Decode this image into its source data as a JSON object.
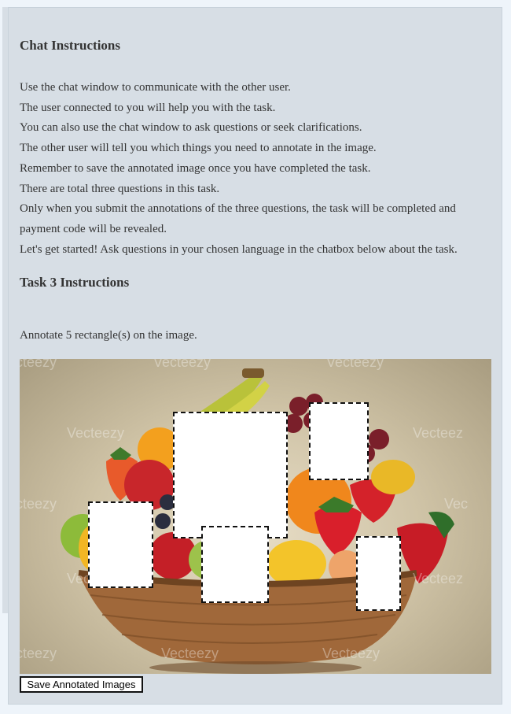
{
  "chat": {
    "title": "Chat Instructions",
    "lines": [
      "Use the chat window to communicate with the other user.",
      "The user connected to you will help you with the task.",
      "You can also use the chat window to ask questions or seek clarifications.",
      "The other user will tell you which things you need to annotate in the image.",
      "Remember to save the annotated image once you have completed the task.",
      "There are total three questions in this task.",
      "Only when you submit the annotations of the three questions, the task will be completed and payment code will be revealed.",
      "Let's get started! Ask questions in your chosen language in the chatbox below about the task."
    ]
  },
  "task": {
    "title": "Task 3 Instructions",
    "instruction": "Annotate 5 rectangle(s) on the image."
  },
  "image": {
    "watermark": "Vecteezy",
    "rectangle_count": 5
  },
  "save_button_label": "Save Annotated Images",
  "colors": {
    "panel_bg": "#d7dee5",
    "page_bg": "#eef4fa",
    "text": "#333333"
  }
}
